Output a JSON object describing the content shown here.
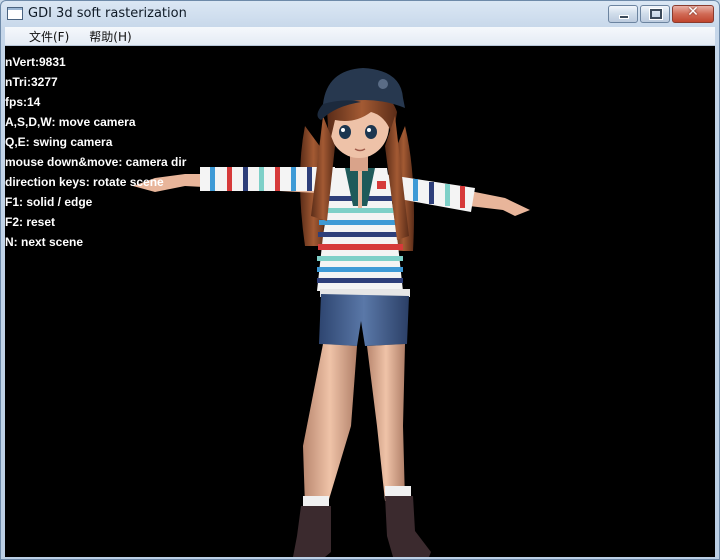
{
  "window": {
    "title": "GDI 3d soft rasterization",
    "minimize_symbol": "▭",
    "maximize_symbol": "▢",
    "close_symbol": "✕"
  },
  "menu": {
    "items": [
      "文件(F)",
      "帮助(H)"
    ]
  },
  "overlay": {
    "lines": [
      "nVert:9831",
      "nTri:3277",
      "fps:14",
      "A,S,D,W: move camera",
      "Q,E: swing camera",
      "mouse down&move: camera dir",
      "direction keys: rotate scene",
      "F1: solid / edge",
      "F2: reset",
      "N: next scene"
    ]
  },
  "scene": {
    "background": "#000000",
    "skin": "#e8b59a",
    "hair": "#8a4a2a",
    "cap": "#27384f",
    "shorts": "#3d5a8a",
    "boots": "#3b2a2e",
    "stripes": [
      "#f4f4f4",
      "#3e9ad6",
      "#d63a3a",
      "#2e3f7a",
      "#7ed0c8",
      "#f0c4c4"
    ]
  }
}
